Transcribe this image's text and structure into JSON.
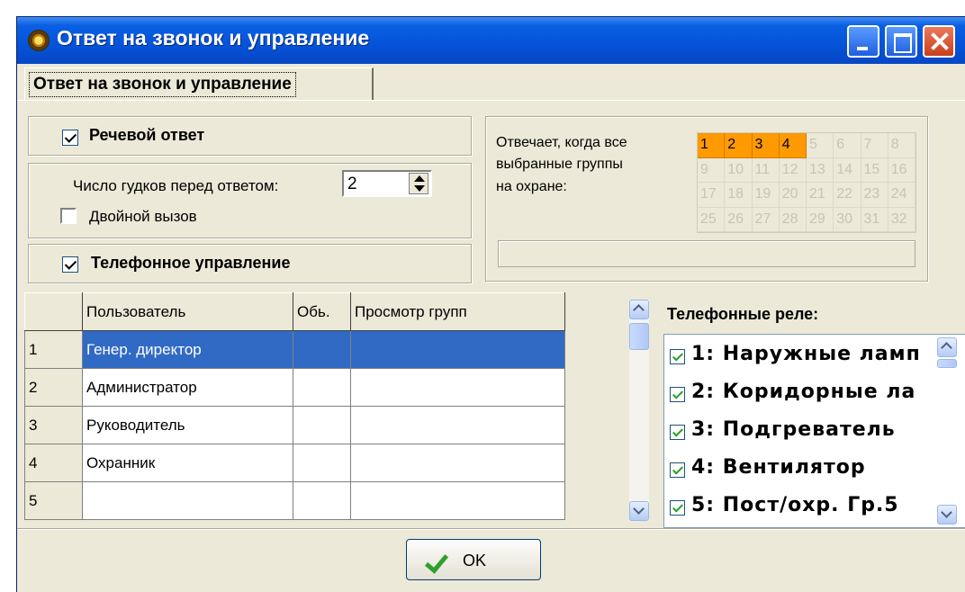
{
  "window": {
    "title": "Ответ на звонок и управление"
  },
  "tab": {
    "label": "Ответ на звонок и управление"
  },
  "voice_answer": {
    "label": "Речевой ответ",
    "checked": true
  },
  "rings": {
    "label": "Число гудков перед ответом:",
    "value": "2"
  },
  "double_call": {
    "label": "Двойной вызов",
    "checked": false
  },
  "phone_control": {
    "label": "Телефонное управление",
    "checked": true
  },
  "groups_panel": {
    "label_line1": "Отвечает, когда все",
    "label_line2": "выбранные группы",
    "label_line3": "на охране:",
    "groups": [
      "1",
      "2",
      "3",
      "4",
      "5",
      "6",
      "7",
      "8",
      "9",
      "10",
      "11",
      "12",
      "13",
      "14",
      "15",
      "16",
      "17",
      "18",
      "19",
      "20",
      "21",
      "22",
      "23",
      "24",
      "25",
      "26",
      "27",
      "28",
      "29",
      "30",
      "31",
      "32"
    ],
    "selected_groups": [
      "1",
      "2",
      "3",
      "4"
    ],
    "selected_color": "#ff9a00"
  },
  "users_table": {
    "columns": [
      "Пользователь",
      "Обь.",
      "Просмотр групп"
    ],
    "rows": [
      {
        "num": "1",
        "user": "Генер. директор",
        "obj": "",
        "groups": "",
        "selected": true
      },
      {
        "num": "2",
        "user": "Администратор",
        "obj": "",
        "groups": ""
      },
      {
        "num": "3",
        "user": "Руководитель",
        "obj": "",
        "groups": ""
      },
      {
        "num": "4",
        "user": "Охранник",
        "obj": "",
        "groups": ""
      },
      {
        "num": "5",
        "user": "",
        "obj": "",
        "groups": ""
      }
    ],
    "selection_color": "#316ac5"
  },
  "relays": {
    "title": "Телефонные реле:",
    "items": [
      "1: Наружные ламп",
      "2: Коридорные ла",
      "3: Подгреватель",
      "4: Вентилятор",
      "5: Пост/охр. Гр.5"
    ]
  },
  "ok_button": {
    "label": "OK"
  }
}
